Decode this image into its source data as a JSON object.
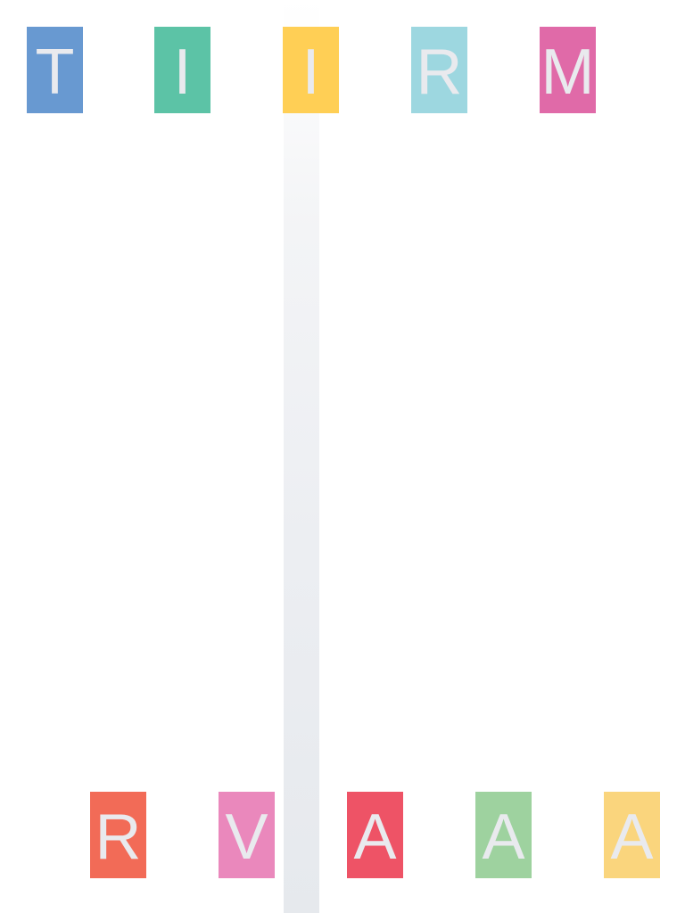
{
  "top_row": {
    "tiles": [
      {
        "letter": "T",
        "color": "#6899d1"
      },
      {
        "letter": "I",
        "color": "#5cc3a6"
      },
      {
        "letter": "I",
        "color": "#ffcf55"
      },
      {
        "letter": "R",
        "color": "#9dd7e0"
      },
      {
        "letter": "M",
        "color": "#e06aa8"
      }
    ]
  },
  "bottom_row": {
    "tiles": [
      {
        "letter": "R",
        "color": "#f26b57"
      },
      {
        "letter": "V",
        "color": "#ea88bc"
      },
      {
        "letter": "A",
        "color": "#ee5366"
      },
      {
        "letter": "A",
        "color": "#9ed29f"
      },
      {
        "letter": "A",
        "color": "#fad57d"
      }
    ]
  },
  "colors": {
    "letter": "#e9eaee",
    "background": "#ffffff",
    "lane": "#e6e9ed"
  }
}
